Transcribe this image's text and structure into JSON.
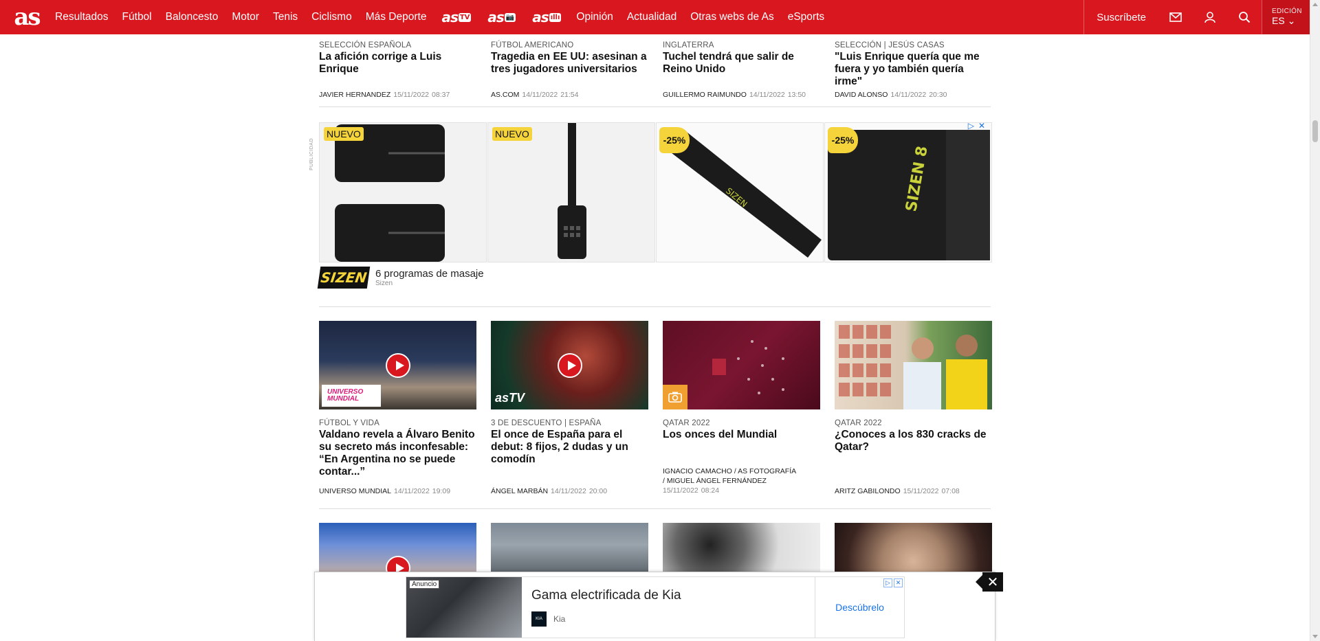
{
  "header": {
    "logo": "as",
    "nav": [
      "Resultados",
      "Fútbol",
      "Baloncesto",
      "Motor",
      "Tenis",
      "Ciclismo",
      "Más Deporte"
    ],
    "brands": [
      {
        "name": "as",
        "sub": "TV"
      },
      {
        "name": "as",
        "sub": "📷"
      },
      {
        "name": "as",
        "sub": "ıllı"
      }
    ],
    "nav2": [
      "Opinión",
      "Actualidad",
      "Otras webs de As",
      "eSports"
    ],
    "subscribe": "Suscríbete",
    "edition_label": "EDICIÓN",
    "edition_value": "ES"
  },
  "top_articles": [
    {
      "kicker": "SELECCIÓN ESPAÑOLA",
      "title": "La afición corrige a Luis Enrique",
      "author": "JAVIER HERNANDEZ",
      "date": "15/11/2022",
      "time": "08:37"
    },
    {
      "kicker": "FÚTBOL AMERICANO",
      "title": "Tragedia en EE UU: asesinan a tres jugadores universitarios",
      "author": "AS.COM",
      "date": "14/11/2022",
      "time": "21:54"
    },
    {
      "kicker": "INGLATERRA",
      "title": "Tuchel tendrá que salir de Reino Unido",
      "author": "GUILLERMO RAIMUNDO",
      "date": "14/11/2022",
      "time": "13:50"
    },
    {
      "kicker": "SELECCIÓN | JESÚS CASAS",
      "title": "\"Luis Enrique quería que me fuera y yo también quería irme\"",
      "author": "DAVID ALONSO",
      "date": "14/11/2022",
      "time": "20:30"
    }
  ],
  "ad": {
    "label": "PUBLICIDAD",
    "badges": [
      "NUEVO",
      "NUEVO",
      "-25%",
      "-25%"
    ],
    "title": "6 programas de masaje",
    "brand": "Sizen",
    "logo": "SIZEN"
  },
  "mid_articles": [
    {
      "kicker": "FÚTBOL Y VIDA",
      "title": "Valdano revela a Álvaro Benito su secreto más inconfesable: “En Argentina no se puede contar...”",
      "author": "UNIVERSO MUNDIAL",
      "date": "14/11/2022",
      "time": "19:09",
      "badge": "UNIVERSO MUNDIAL"
    },
    {
      "kicker": "3 DE DESCUENTO | ESPAÑA",
      "title": "El once de España para el debut: 8 fijos, 2 dudas y un comodín",
      "author": "ÁNGEL MARBÁN",
      "date": "14/11/2022",
      "time": "20:00",
      "badge": "asTV"
    },
    {
      "kicker": "QATAR 2022",
      "title": "Los onces del Mundial",
      "authors": [
        "IGNACIO CAMACHO",
        "AS FOTOGRAFÍA",
        "MIGUEL ÁNGEL FERNÁNDEZ"
      ],
      "date": "15/11/2022",
      "time": "08:24"
    },
    {
      "kicker": "QATAR 2022",
      "title": "¿Conoces a los 830 cracks de Qatar?",
      "author": "ARITZ GABILONDO",
      "date": "15/11/2022",
      "time": "07:08"
    }
  ],
  "sticky_ad": {
    "label": "Anuncio",
    "title": "Gama electrificada de Kia",
    "brand": "Kia",
    "cta": "Descúbrelo"
  }
}
